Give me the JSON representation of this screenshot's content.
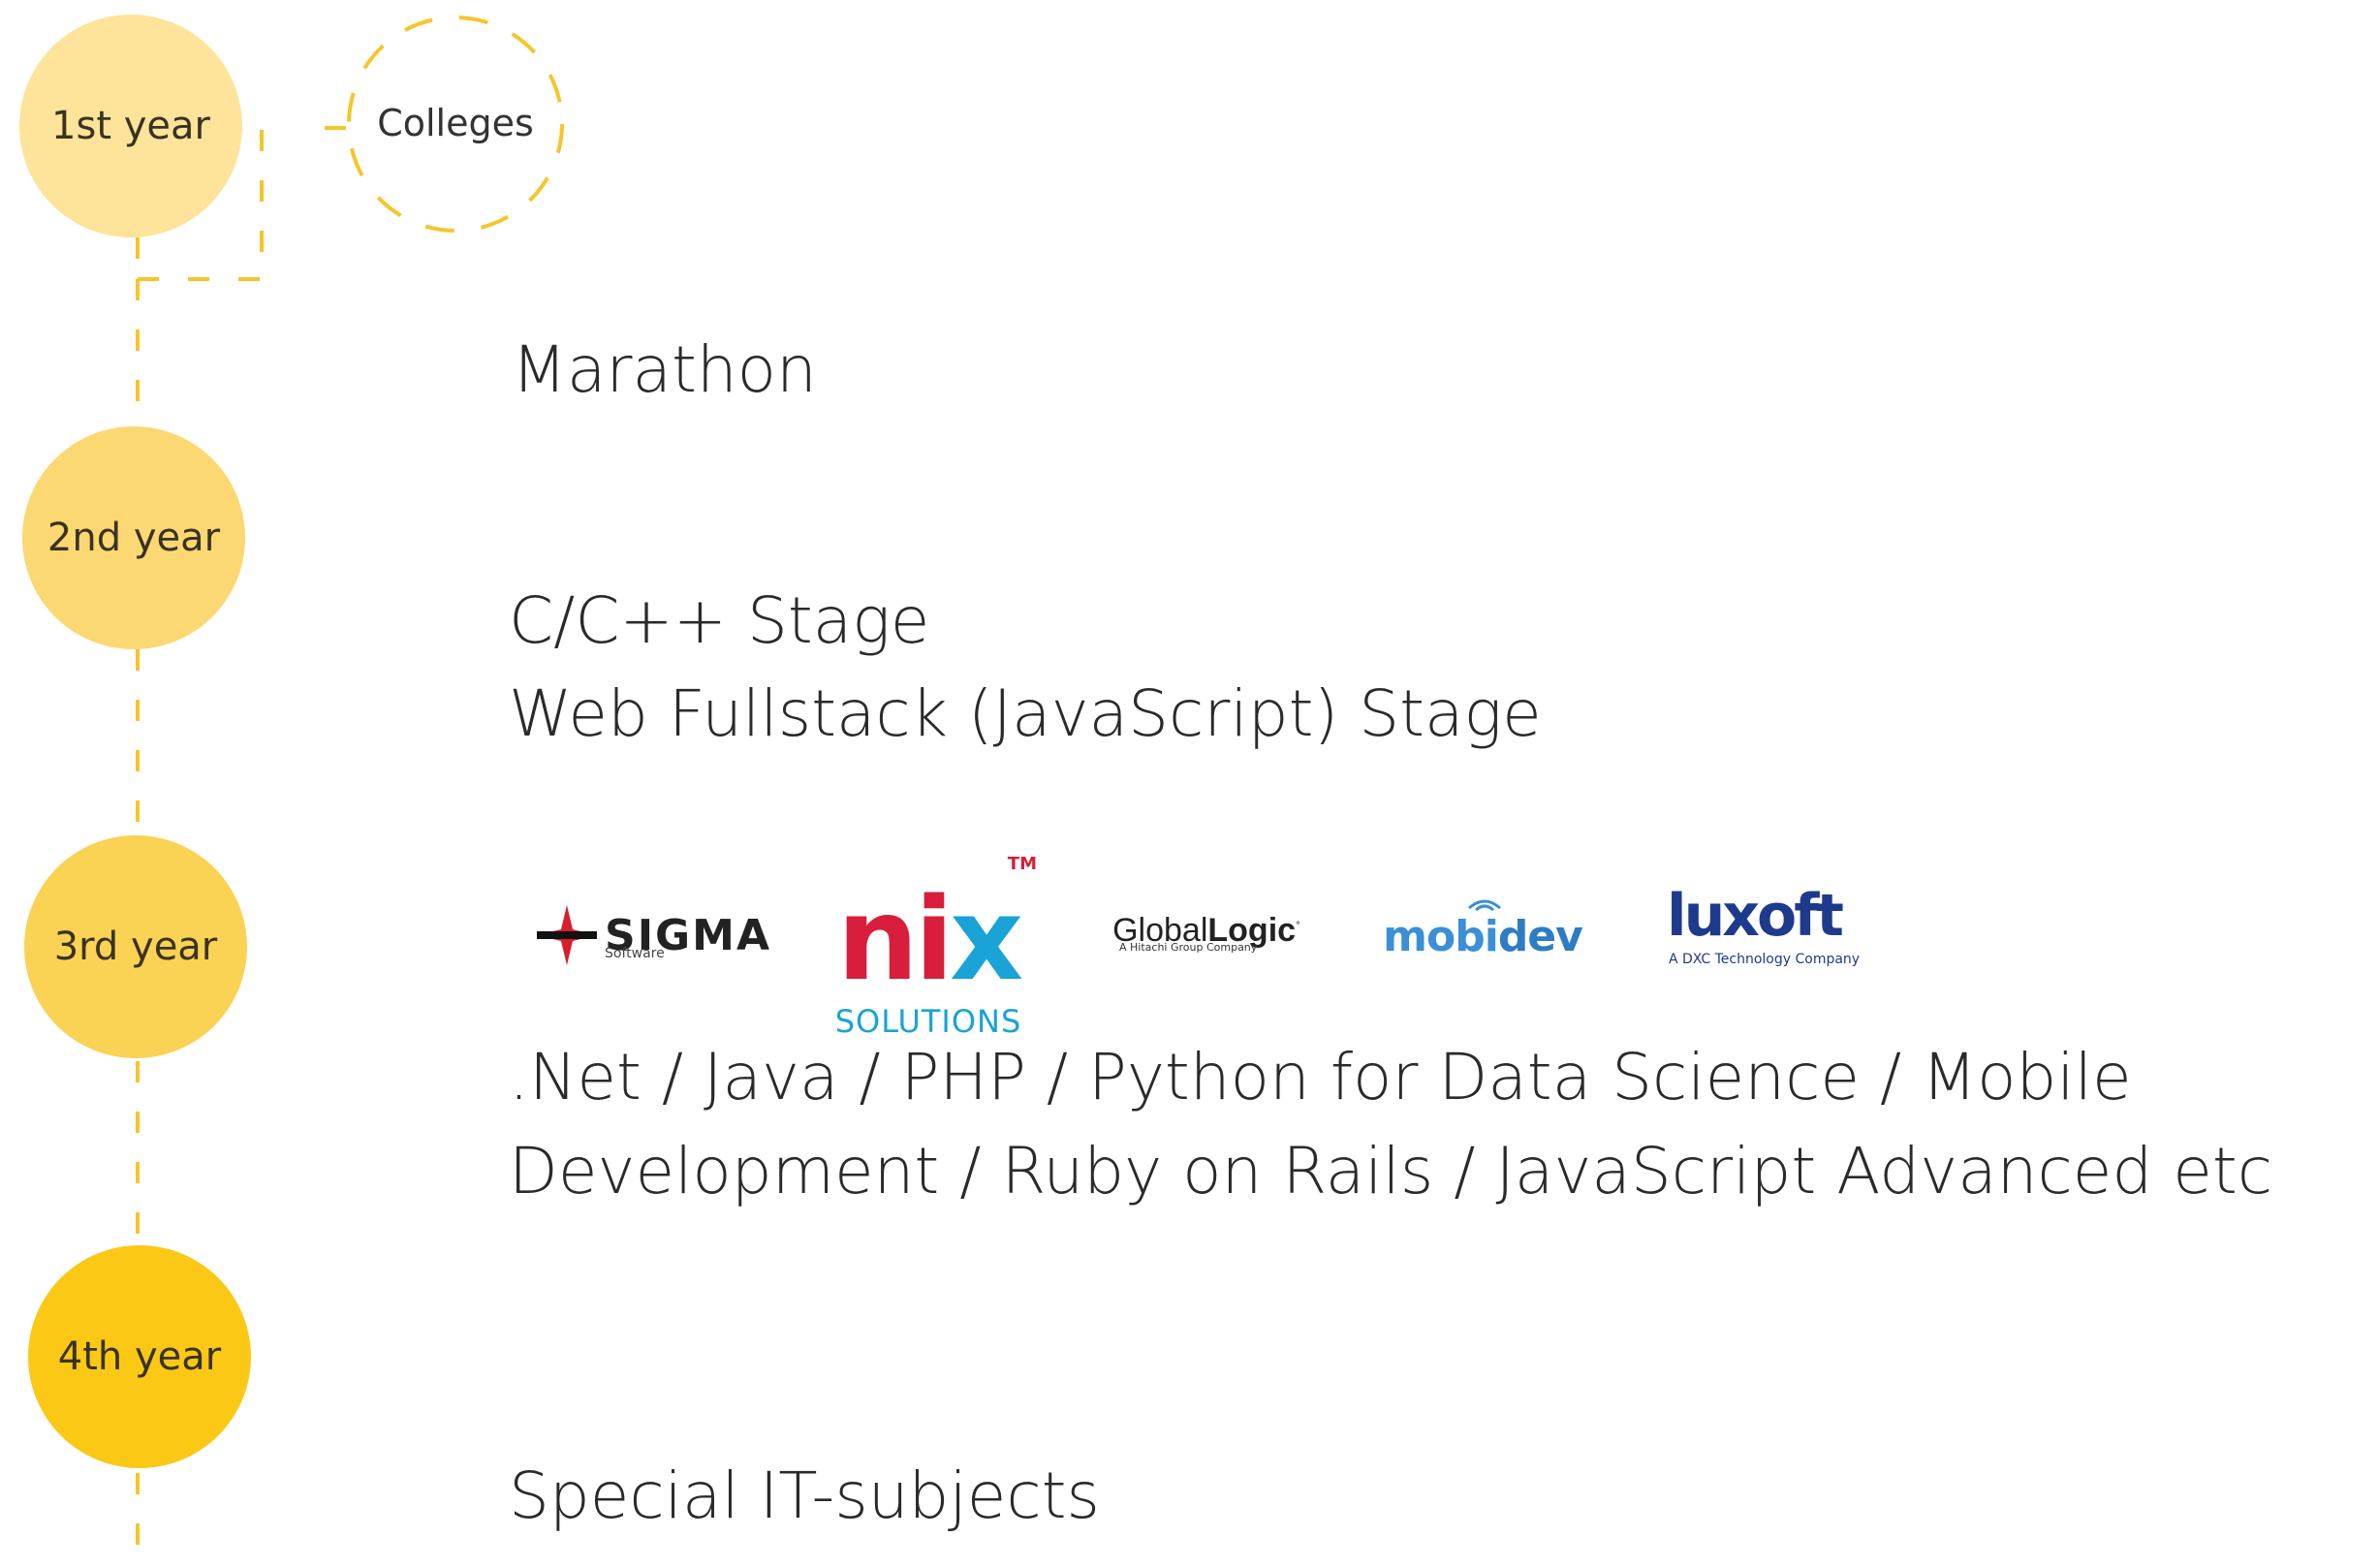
{
  "timeline": {
    "years": [
      {
        "label": "1st year",
        "color": "#fde49a"
      },
      {
        "label": "2nd year",
        "color": "#fcd873"
      },
      {
        "label": "3rd year",
        "color": "#fad254"
      },
      {
        "label": "4th year",
        "color": "#fbc815"
      }
    ],
    "line_color": "#f7c52a"
  },
  "colleges": {
    "label": "Colleges"
  },
  "stages": {
    "marathon": "Marathon",
    "stage2_line1": "C/C++ Stage",
    "stage2_line2": "Web Fullstack (JavaScript) Stage",
    "stage3_line1": ".Net / Java / PHP / Python for Data Science / Mobile",
    "stage3_line2": "Development / Ruby on Rails / JavaScript Advanced etc",
    "stage4": "Special IT-subjects"
  },
  "logos": {
    "sigma": {
      "name": "SIGMA",
      "sub": "Software"
    },
    "nix": {
      "name": "nix",
      "sub": "SOLUTIONS",
      "tm": "TM"
    },
    "globallogic": {
      "name_light": "Global",
      "name_bold": "Logic",
      "sub": "A Hitachi Group Company"
    },
    "mobidev": {
      "name_a": "mobi",
      "name_b": "dev"
    },
    "luxoft": {
      "name": "luxoft",
      "sub": "A DXC Technology Company"
    }
  }
}
